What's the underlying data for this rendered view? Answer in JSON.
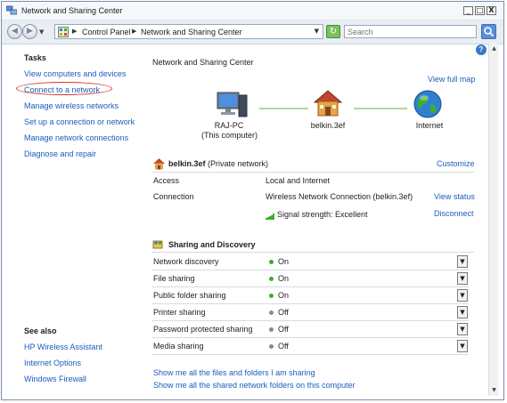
{
  "window": {
    "title": "Network and Sharing Center",
    "controls": {
      "minimize": "_",
      "maximize": "□",
      "close": "X"
    }
  },
  "address_bar": {
    "breadcrumbs": [
      "Control Panel",
      "Network and Sharing Center"
    ],
    "search_placeholder": "Search"
  },
  "sidebar": {
    "tasks_header": "Tasks",
    "tasks": [
      "View computers and devices",
      "Connect to a network",
      "Manage wireless networks",
      "Set up a connection or network",
      "Manage network connections",
      "Diagnose and repair"
    ],
    "see_also_header": "See also",
    "see_also": [
      "HP Wireless Assistant",
      "Internet Options",
      "Windows Firewall"
    ]
  },
  "main": {
    "title": "Network and Sharing Center",
    "view_full_map": "View full map",
    "map_nodes": {
      "computer_name": "RAJ-PC",
      "computer_sub": "(This computer)",
      "network_name": "belkin.3ef",
      "internet": "Internet"
    },
    "network": {
      "name": "belkin.3ef",
      "type": "(Private network)",
      "customize": "Customize",
      "access_label": "Access",
      "access_value": "Local and Internet",
      "connection_label": "Connection",
      "connection_value": "Wireless Network Connection (belkin.3ef)",
      "view_status": "View status",
      "signal": "Signal strength:  Excellent",
      "disconnect": "Disconnect"
    },
    "sharing": {
      "title": "Sharing and Discovery",
      "rows": [
        {
          "label": "Network discovery",
          "state": "On"
        },
        {
          "label": "File sharing",
          "state": "On"
        },
        {
          "label": "Public folder sharing",
          "state": "On"
        },
        {
          "label": "Printer sharing",
          "state": "Off"
        },
        {
          "label": "Password protected sharing",
          "state": "Off"
        },
        {
          "label": "Media sharing",
          "state": "Off"
        }
      ]
    },
    "links": [
      "Show me all the files and folders I am sharing",
      "Show me all the shared network folders on this computer"
    ]
  },
  "colors": {
    "link": "#1a5dbd",
    "on": "#3fae2a",
    "off": "#8a8a8a",
    "highlight_oval": "#d4382c"
  }
}
